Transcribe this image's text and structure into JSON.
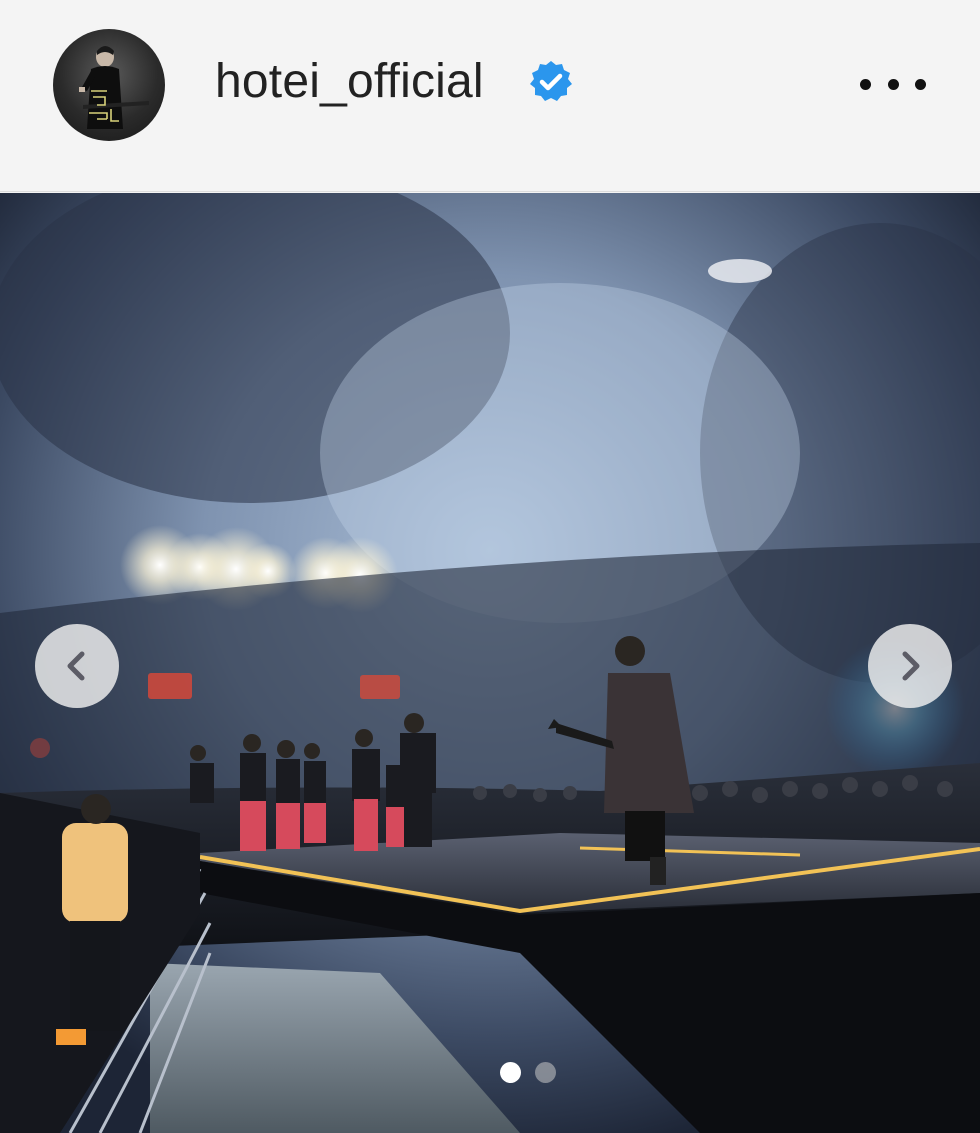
{
  "post": {
    "username": "hotei_official",
    "verified": true
  },
  "icons": {
    "avatar": "profile-avatar",
    "verified": "verified-badge-icon",
    "more": "more-options-icon",
    "prev": "chevron-left-icon",
    "next": "chevron-right-icon"
  },
  "carousel": {
    "slide_count": 2,
    "current_slide": 1
  },
  "colors": {
    "verified_blue": "#2b96ed",
    "background": "#f4f4f4"
  }
}
